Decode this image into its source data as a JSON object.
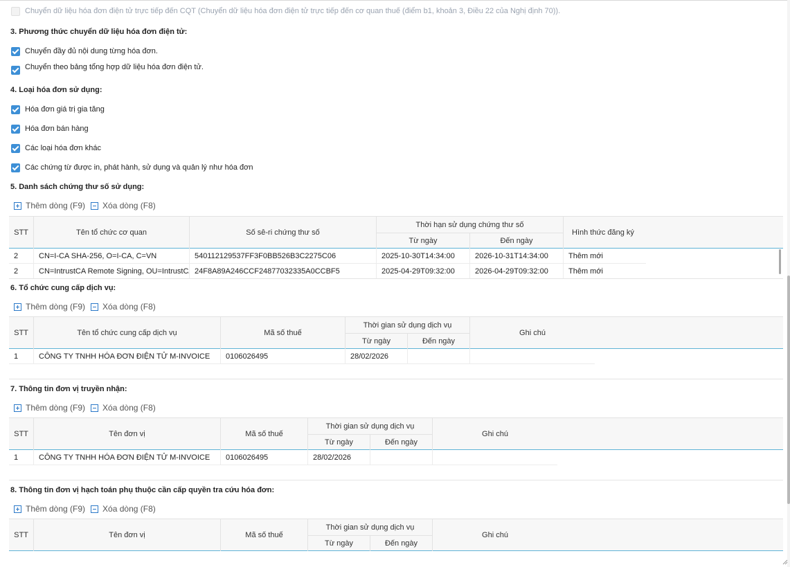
{
  "section2": {
    "option_direct_label": "Chuyển dữ liệu hóa đơn điện tử trực tiếp đến CQT (Chuyển dữ liệu hóa đơn điện tử trực tiếp đến cơ quan thuế (điểm b1, khoản 3, Điều 22 của Nghị định 70))."
  },
  "section3": {
    "heading": "3. Phương thức chuyển dữ liệu hóa đơn điện tử:",
    "options": [
      {
        "label": "Chuyển đầy đủ nội dung từng hóa đơn."
      },
      {
        "label": "Chuyển theo bảng tổng hợp dữ liệu hóa đơn điện tử."
      }
    ]
  },
  "section4": {
    "heading": "4. Loại hóa đơn sử dụng:",
    "options": [
      {
        "label": "Hóa đơn giá trị gia tăng"
      },
      {
        "label": "Hóa đơn bán hàng"
      },
      {
        "label": "Các loại hóa đơn khác"
      },
      {
        "label": "Các chứng từ được in, phát hành, sử dụng và quản lý như hóa đơn"
      }
    ]
  },
  "toolbar": {
    "add_label": "Thêm dòng (F9)",
    "delete_label": "Xóa dòng (F8)"
  },
  "section5": {
    "heading": "5. Danh sách chứng thư số sử dụng:",
    "headers": {
      "stt": "STT",
      "org": "Tên tổ chức cơ quan",
      "serial": "Số sê-ri chứng thư số",
      "period": "Thời hạn sử dụng chứng thư số",
      "from": "Từ ngày",
      "to": "Đến ngày",
      "form": "Hình thức đăng ký"
    },
    "rows": [
      {
        "stt": "2",
        "org": "CN=I-CA SHA-256, O=I-CA, C=VN",
        "serial": "540112129537FF3F0BB526B3C2275C06",
        "from": "2025-10-30T14:34:00",
        "to": "2026-10-31T14:34:00",
        "form": "Thêm mới"
      },
      {
        "stt": "2",
        "org": "CN=IntrustCA Remote Signing, OU=IntrustCA",
        "serial": "24F8A89A246CCF24877032335A0CCBF5",
        "from": "2025-04-29T09:32:00",
        "to": "2026-04-29T09:32:00",
        "form": "Thêm mới"
      }
    ]
  },
  "section6": {
    "heading": "6. Tổ chức cung cấp dịch vụ:",
    "headers": {
      "stt": "STT",
      "name": "Tên tổ chức cung cấp dịch vụ",
      "tax": "Mã số thuế",
      "period": "Thời gian sử dụng dịch vụ",
      "from": "Từ ngày",
      "to": "Đến ngày",
      "note": "Ghi chú"
    },
    "rows": [
      {
        "stt": "1",
        "name": "CÔNG TY TNHH HÓA ĐƠN ĐIỆN TỬ M-INVOICE",
        "tax": "0106026495",
        "from": "28/02/2026",
        "to": "",
        "note": ""
      }
    ]
  },
  "section7": {
    "heading": "7. Thông tin đơn vị truyền nhận:",
    "headers": {
      "stt": "STT",
      "name": "Tên đơn vị",
      "tax": "Mã số thuế",
      "period": "Thời gian sử dụng dịch vụ",
      "from": "Từ ngày",
      "to": "Đến ngày",
      "note": "Ghi chú"
    },
    "rows": [
      {
        "stt": "1",
        "name": "CÔNG TY TNHH HÓA ĐƠN ĐIỆN TỬ M-INVOICE",
        "tax": "0106026495",
        "from": "28/02/2026",
        "to": "",
        "note": ""
      }
    ]
  },
  "section8": {
    "heading": "8. Thông tin đơn vị hạch toán phụ thuộc cần cấp quyền tra cứu hóa đơn:",
    "headers": {
      "stt": "STT",
      "name": "Tên đơn vị",
      "tax": "Mã số thuế",
      "period": "Thời gian sử dụng dịch vụ",
      "from": "Từ ngày",
      "to": "Đến ngày",
      "note": "Ghi chú"
    },
    "rows": []
  },
  "colors": {
    "checkbox": "#3d8fd6",
    "icon": "#2a78c8",
    "header_line": "#5fb3d6"
  }
}
